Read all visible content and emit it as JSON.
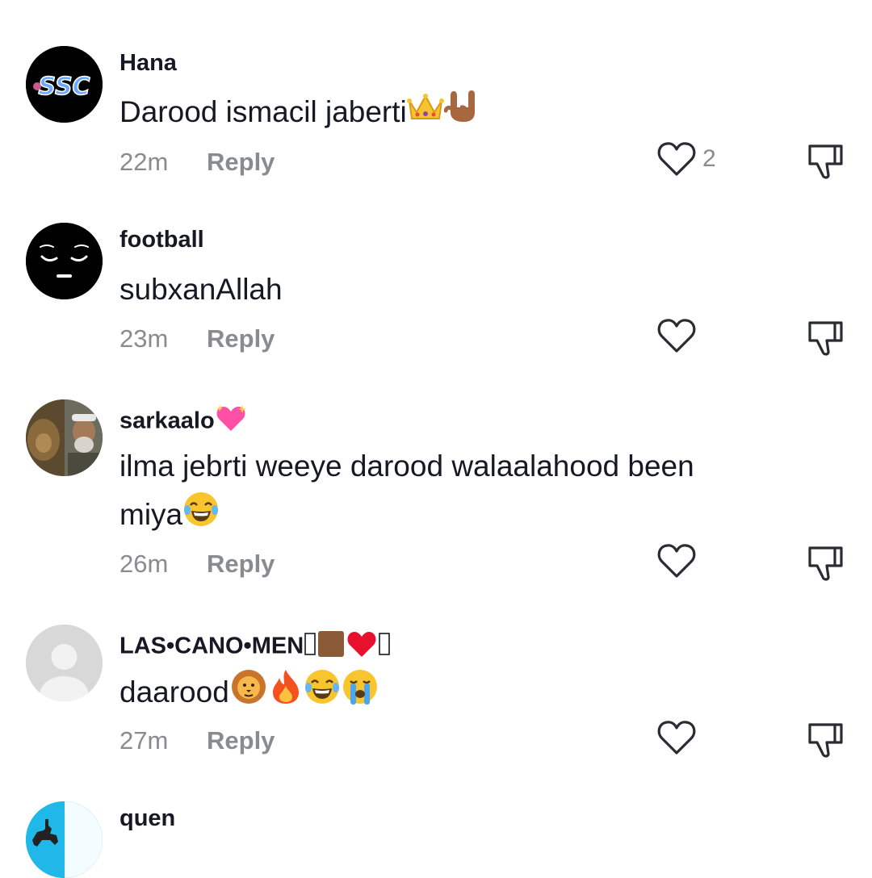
{
  "reply_label": "Reply",
  "comments": [
    {
      "avatar": "avatar-ssc-logo",
      "username": "Hana",
      "text": "Darood ismacil jaberti",
      "emojis": [
        "crown-emoji",
        "love-you-gesture-emoji"
      ],
      "time": "22m",
      "likes": "2"
    },
    {
      "avatar": "avatar-pensive-face",
      "username": "football",
      "text": "subxanAllah",
      "time": "23m",
      "likes": ""
    },
    {
      "avatar": "avatar-photo-lion-man",
      "username": "sarkaalo",
      "username_emoji": "sparkling-heart-emoji",
      "text_line1": "ilma jebrti weeye darood walaalahood been",
      "text_line2": "miya",
      "emojis": [
        "tears-of-joy-emoji"
      ],
      "time": "26m",
      "likes": ""
    },
    {
      "avatar": "avatar-default-gray",
      "username": "LAS•CANO•MEN",
      "username_emojis": [
        "missing-glyph",
        "brown-square-emoji",
        "red-heart-emoji",
        "missing-glyph"
      ],
      "text": "daarood",
      "emojis": [
        "lion-emoji",
        "fire-emoji",
        "tears-of-joy-emoji",
        "loudly-crying-emoji"
      ],
      "time": "27m",
      "likes": ""
    },
    {
      "avatar": "avatar-horse-rider",
      "username": "quen"
    }
  ],
  "colors": {
    "text_primary": "#161823",
    "text_secondary": "#8a8b91",
    "avatar_gray": "#d8d8d8",
    "avatar_blue": "#1fb8e8"
  },
  "icons": [
    "heart-outline-icon",
    "thumb-down-outline-icon"
  ]
}
